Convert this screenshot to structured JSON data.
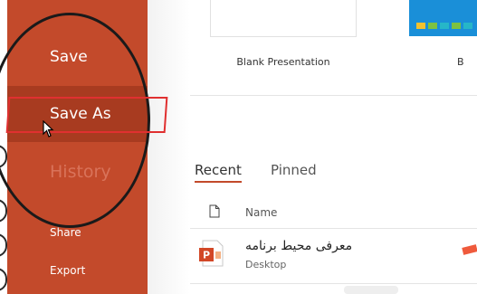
{
  "sidebar": {
    "items": [
      {
        "label": "Save"
      },
      {
        "label": "Save As"
      },
      {
        "label": "History"
      },
      {
        "label": "Share"
      },
      {
        "label": "Export"
      }
    ],
    "color": "#c34a2b",
    "selected_color": "#a83b20"
  },
  "templates": {
    "blank_label": "Blank Presentation",
    "second_label": "B"
  },
  "tabs": [
    {
      "label": "Recent",
      "active": true
    },
    {
      "label": "Pinned",
      "active": false
    }
  ],
  "file_list": {
    "column_name": "Name",
    "files": [
      {
        "name": "معرفی محیط برنامه",
        "location": "Desktop",
        "icon": "powerpoint-file-icon"
      }
    ]
  },
  "annotations": {
    "circle_color": "#1a1a1a",
    "box_color": "#e03030"
  }
}
